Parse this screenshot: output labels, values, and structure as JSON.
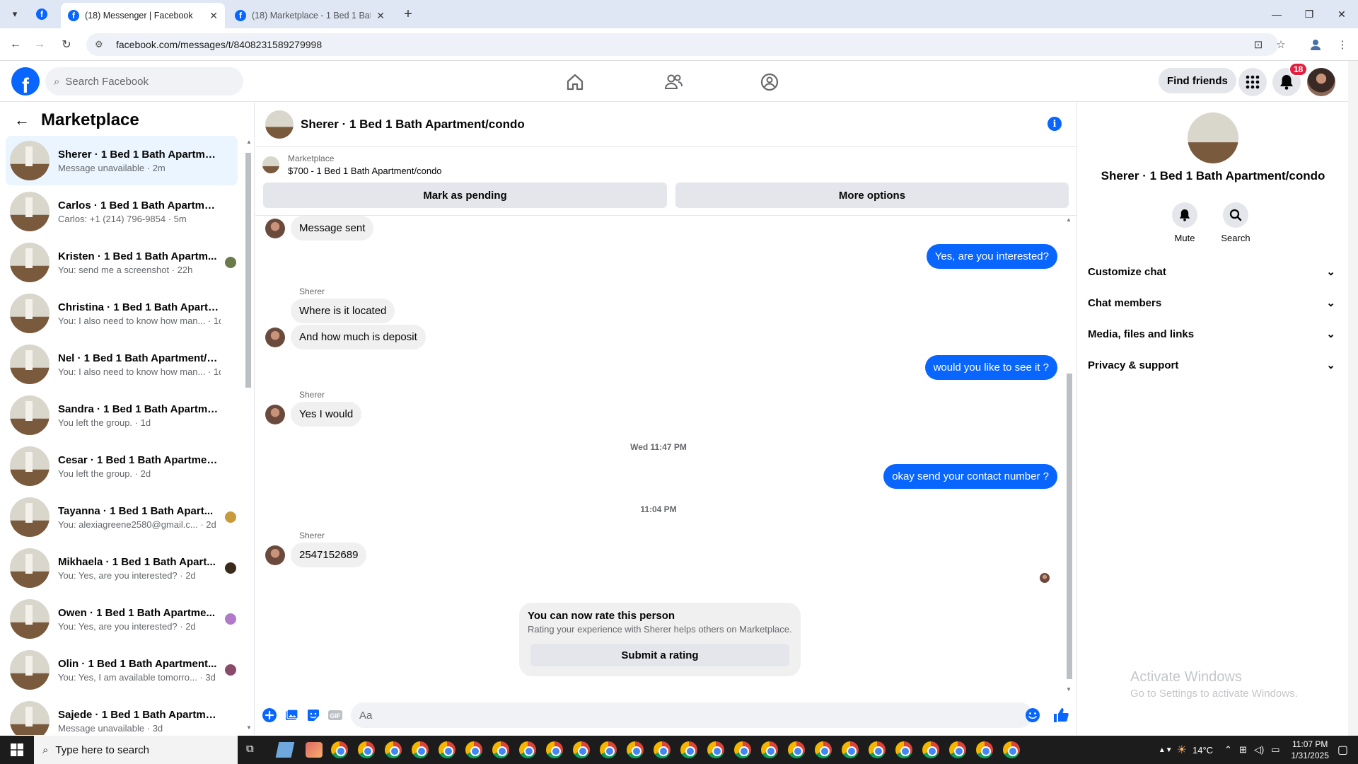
{
  "browser": {
    "tabs": [
      {
        "title": "(18) Messenger | Facebook",
        "active": true
      },
      {
        "title": "(18) Marketplace - 1 Bed 1 Bath",
        "active": false
      }
    ],
    "url": "facebook.com/messages/t/8408231589279998"
  },
  "header": {
    "search_placeholder": "Search Facebook",
    "find_friends": "Find friends",
    "notification_count": "18"
  },
  "sidebar": {
    "title": "Marketplace",
    "conversations": [
      {
        "name": "Sherer · 1 Bed 1 Bath Apartment...",
        "preview": "Message unavailable · 2m",
        "selected": true,
        "read_color": ""
      },
      {
        "name": "Carlos · 1 Bed 1 Bath Apartment...",
        "preview": "Carlos: +1 (214) 796-9854 · 5m",
        "selected": false,
        "read_color": ""
      },
      {
        "name": "Kristen · 1 Bed 1 Bath Apartm...",
        "preview": "You: send me a screenshot · 22h",
        "selected": false,
        "read_color": "#6b7a4a"
      },
      {
        "name": "Christina · 1 Bed 1 Bath Apartme...",
        "preview": "You: I also need to know how man... · 1d",
        "selected": false,
        "read_color": ""
      },
      {
        "name": "Nel · 1 Bed 1 Bath Apartment/co...",
        "preview": "You: I also need to know how man... · 1d",
        "selected": false,
        "read_color": ""
      },
      {
        "name": "Sandra · 1 Bed 1 Bath Apartment...",
        "preview": "You left the group. · 1d",
        "selected": false,
        "read_color": ""
      },
      {
        "name": "Cesar · 1 Bed 1 Bath Apartment/...",
        "preview": "You left the group. · 2d",
        "selected": false,
        "read_color": ""
      },
      {
        "name": "Tayanna · 1 Bed 1 Bath Apart...",
        "preview": "You: alexiagreene2580@gmail.c... · 2d",
        "selected": false,
        "read_color": "#c89a3c"
      },
      {
        "name": "Mikhaela · 1 Bed 1 Bath Apart...",
        "preview": "You: Yes, are you interested? · 2d",
        "selected": false,
        "read_color": "#3a2a1c"
      },
      {
        "name": "Owen · 1 Bed 1 Bath Apartme...",
        "preview": "You: Yes, are you interested? · 2d",
        "selected": false,
        "read_color": "#b07ac8"
      },
      {
        "name": "Olin · 1 Bed 1 Bath Apartment...",
        "preview": "You: Yes, I am available tomorro... · 3d",
        "selected": false,
        "read_color": "#8a4a6a"
      },
      {
        "name": "Sajede · 1 Bed 1 Bath Apartment...",
        "preview": "Message unavailable · 3d",
        "selected": false,
        "read_color": ""
      }
    ]
  },
  "chat": {
    "title": "Sherer · 1 Bed 1 Bath Apartment/condo",
    "listing_label": "Marketplace",
    "listing_price": "$700 - 1 Bed 1 Bath Apartment/condo",
    "mark_pending": "Mark as pending",
    "more_options": "More options",
    "messages": {
      "m1": "Message sent",
      "m2": "Yes, are you interested?",
      "sender1": "Sherer",
      "m3": "Where is it located",
      "m4": "And how much is deposit",
      "m5": "would you like to see it ?",
      "sender2": "Sherer",
      "m6": "Yes I would",
      "time1": "Wed 11:47 PM",
      "m7": "okay send your contact number ?",
      "time2": "11:04 PM",
      "sender3": "Sherer",
      "m8": "2547152689"
    },
    "rating": {
      "title": "You can now rate this person",
      "subtitle": "Rating your experience with Sherer helps others on Marketplace.",
      "button": "Submit a rating"
    },
    "input_placeholder": "Aa"
  },
  "right_panel": {
    "name": "Sherer · 1 Bed 1 Bath Apartment/condo",
    "mute": "Mute",
    "search": "Search",
    "sections": [
      "Customize chat",
      "Chat members",
      "Media, files and links",
      "Privacy & support"
    ]
  },
  "watermark": {
    "line1": "Activate Windows",
    "line2": "Go to Settings to activate Windows."
  },
  "taskbar": {
    "search_placeholder": "Type here to search",
    "temperature": "14°C",
    "time": "11:07 PM",
    "date": "1/31/2025"
  }
}
